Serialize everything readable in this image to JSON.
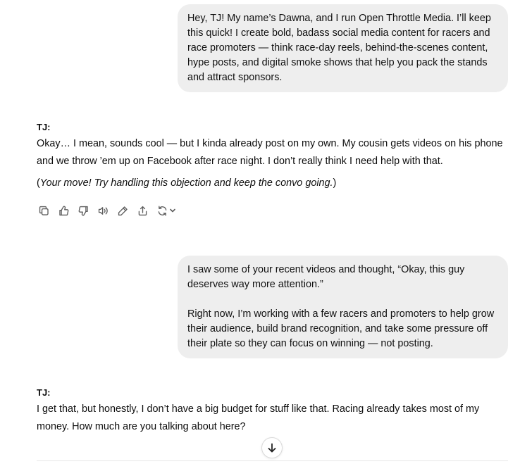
{
  "conversation": {
    "message_1": {
      "text": "Hey, TJ! My name’s Dawna, and I run Open Throttle Media. I’ll keep this quick! I create bold, badass social media content for racers and race promoters — think race-day reels, behind-the-scenes content, hype posts, and digital smoke shows that help you pack the stands and attract sponsors."
    },
    "message_2": {
      "speaker": "TJ:",
      "text": "Okay… I mean, sounds cool — but I kinda already post on my own. My cousin gets videos on his phone and we throw ’em up on Facebook after race night. I don’t really think I need help with that.",
      "note_open": "(",
      "note_italic": "Your move! Try handling this objection and keep the convo going.",
      "note_close": ")"
    },
    "message_3": {
      "paragraph_1": "I saw some of your recent videos and thought, “Okay, this guy deserves way more attention.”",
      "paragraph_2": "Right now, I’m working with a few racers and promoters to help grow their audience, build brand recognition, and take some pressure off their plate so they can focus on winning — not posting."
    },
    "message_4": {
      "speaker": "TJ:",
      "text": "I get that, but honestly, I don’t have a big budget for stuff like that. Racing already takes most of my money. How much are you talking about here?"
    }
  },
  "action_bar": {
    "icons": [
      "copy-icon",
      "thumbs-up-icon",
      "thumbs-down-icon",
      "read-aloud-icon",
      "edit-icon",
      "share-icon",
      "regenerate-icon",
      "chevron-down-icon"
    ]
  },
  "scroll_button": {
    "icon": "arrow-down-icon"
  },
  "colors": {
    "user_bubble_bg": "#eeeeee",
    "text": "#0d0d0d",
    "icon": "#5d5d5d"
  }
}
